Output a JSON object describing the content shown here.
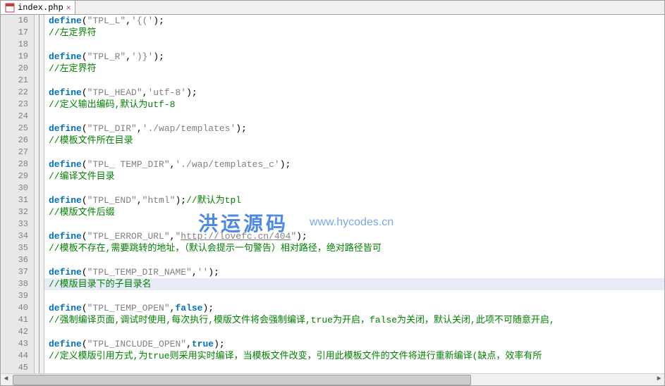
{
  "tab": {
    "filename": "index.php",
    "close": "✕"
  },
  "watermark": {
    "title": "洪运源码",
    "url": "www.hycodes.cn"
  },
  "highlighted_line": 38,
  "lines": [
    {
      "n": 16,
      "t": "define",
      "seg": [
        {
          "c": "kw",
          "v": "define"
        },
        {
          "c": "",
          "v": "("
        },
        {
          "c": "str",
          "v": "\"TPL_L\""
        },
        {
          "c": "",
          "v": ","
        },
        {
          "c": "str",
          "v": "'{('"
        },
        {
          "c": "",
          "v": ");"
        }
      ]
    },
    {
      "n": 17,
      "t": "comment",
      "seg": [
        {
          "c": "com",
          "v": "//左定界符"
        }
      ]
    },
    {
      "n": 18,
      "t": "blank",
      "seg": []
    },
    {
      "n": 19,
      "t": "define",
      "seg": [
        {
          "c": "kw",
          "v": "define"
        },
        {
          "c": "",
          "v": "("
        },
        {
          "c": "str",
          "v": "\"TPL_R\""
        },
        {
          "c": "",
          "v": ","
        },
        {
          "c": "str",
          "v": "')}'"
        },
        {
          "c": "",
          "v": ");"
        }
      ]
    },
    {
      "n": 20,
      "t": "comment",
      "seg": [
        {
          "c": "com",
          "v": "//左定界符"
        }
      ]
    },
    {
      "n": 21,
      "t": "blank",
      "seg": []
    },
    {
      "n": 22,
      "t": "define",
      "seg": [
        {
          "c": "kw",
          "v": "define"
        },
        {
          "c": "",
          "v": "("
        },
        {
          "c": "str",
          "v": "\"TPL_HEAD\""
        },
        {
          "c": "",
          "v": ","
        },
        {
          "c": "str",
          "v": "'utf-8'"
        },
        {
          "c": "",
          "v": ");"
        }
      ]
    },
    {
      "n": 23,
      "t": "comment",
      "seg": [
        {
          "c": "com",
          "v": "//定义输出编码,默认为utf-8"
        }
      ]
    },
    {
      "n": 24,
      "t": "blank",
      "seg": []
    },
    {
      "n": 25,
      "t": "define",
      "seg": [
        {
          "c": "kw",
          "v": "define"
        },
        {
          "c": "",
          "v": "("
        },
        {
          "c": "str",
          "v": "\"TPL_DIR\""
        },
        {
          "c": "",
          "v": ","
        },
        {
          "c": "str",
          "v": "'./wap/templates'"
        },
        {
          "c": "",
          "v": ");"
        }
      ]
    },
    {
      "n": 26,
      "t": "comment",
      "seg": [
        {
          "c": "com",
          "v": "//模板文件所在目录"
        }
      ]
    },
    {
      "n": 27,
      "t": "blank",
      "seg": []
    },
    {
      "n": 28,
      "t": "define",
      "seg": [
        {
          "c": "kw",
          "v": "define"
        },
        {
          "c": "",
          "v": "("
        },
        {
          "c": "str",
          "v": "\"TPL_ TEMP_DIR\""
        },
        {
          "c": "",
          "v": ","
        },
        {
          "c": "str",
          "v": "'./wap/templates_c'"
        },
        {
          "c": "",
          "v": ");"
        }
      ]
    },
    {
      "n": 29,
      "t": "comment",
      "seg": [
        {
          "c": "com",
          "v": "//编译文件目录"
        }
      ]
    },
    {
      "n": 30,
      "t": "blank",
      "seg": []
    },
    {
      "n": 31,
      "t": "define",
      "seg": [
        {
          "c": "kw",
          "v": "define"
        },
        {
          "c": "",
          "v": "("
        },
        {
          "c": "str",
          "v": "\"TPL_END\""
        },
        {
          "c": "",
          "v": ","
        },
        {
          "c": "str",
          "v": "\"html\""
        },
        {
          "c": "",
          "v": ");"
        },
        {
          "c": "com",
          "v": "//默认为tpl"
        }
      ]
    },
    {
      "n": 32,
      "t": "comment",
      "seg": [
        {
          "c": "com",
          "v": "//模版文件后缀"
        }
      ]
    },
    {
      "n": 33,
      "t": "blank",
      "seg": []
    },
    {
      "n": 34,
      "t": "define",
      "seg": [
        {
          "c": "kw",
          "v": "define"
        },
        {
          "c": "",
          "v": "("
        },
        {
          "c": "str",
          "v": "\"TPL_ERROR_URL\""
        },
        {
          "c": "",
          "v": ","
        },
        {
          "c": "str",
          "v": "\""
        },
        {
          "c": "url",
          "v": "http://lovefc.cn/404"
        },
        {
          "c": "str",
          "v": "\""
        },
        {
          "c": "",
          "v": ");"
        }
      ]
    },
    {
      "n": 35,
      "t": "comment",
      "seg": [
        {
          "c": "com",
          "v": "//模板不存在,需要跳转的地址，（默认会提示一句警告）相对路径，绝对路径皆可"
        }
      ]
    },
    {
      "n": 36,
      "t": "blank",
      "seg": []
    },
    {
      "n": 37,
      "t": "define",
      "seg": [
        {
          "c": "kw",
          "v": "define"
        },
        {
          "c": "",
          "v": "("
        },
        {
          "c": "str",
          "v": "\"TPL_TEMP_DIR_NAME\""
        },
        {
          "c": "",
          "v": ","
        },
        {
          "c": "str",
          "v": "''"
        },
        {
          "c": "",
          "v": ");"
        }
      ]
    },
    {
      "n": 38,
      "t": "comment",
      "seg": [
        {
          "c": "com",
          "v": "//模版目录下的子目录名"
        }
      ]
    },
    {
      "n": 39,
      "t": "blank",
      "seg": []
    },
    {
      "n": 40,
      "t": "define",
      "seg": [
        {
          "c": "kw",
          "v": "define"
        },
        {
          "c": "",
          "v": "("
        },
        {
          "c": "str",
          "v": "\"TPL_TEMP_OPEN\""
        },
        {
          "c": "",
          "v": ","
        },
        {
          "c": "bool",
          "v": "false"
        },
        {
          "c": "",
          "v": ");"
        }
      ]
    },
    {
      "n": 41,
      "t": "comment",
      "seg": [
        {
          "c": "com",
          "v": "//强制编译页面,调试时使用,每次执行,模版文件将会强制编译,true为开启，false为关闭，默认关闭,此项不可随意开启,"
        }
      ]
    },
    {
      "n": 42,
      "t": "blank",
      "seg": []
    },
    {
      "n": 43,
      "t": "define",
      "seg": [
        {
          "c": "kw",
          "v": "define"
        },
        {
          "c": "",
          "v": "("
        },
        {
          "c": "str",
          "v": "\"TPL_INCLUDE_OPEN\""
        },
        {
          "c": "",
          "v": ","
        },
        {
          "c": "bool",
          "v": "true"
        },
        {
          "c": "",
          "v": ");"
        }
      ]
    },
    {
      "n": 44,
      "t": "comment",
      "seg": [
        {
          "c": "com",
          "v": "//定义模版引用方式,为true则采用实时编译，当模板文件改变，引用此模板文件的文件将进行重新编译(缺点，效率有所"
        }
      ]
    },
    {
      "n": 45,
      "t": "blank",
      "seg": []
    }
  ]
}
